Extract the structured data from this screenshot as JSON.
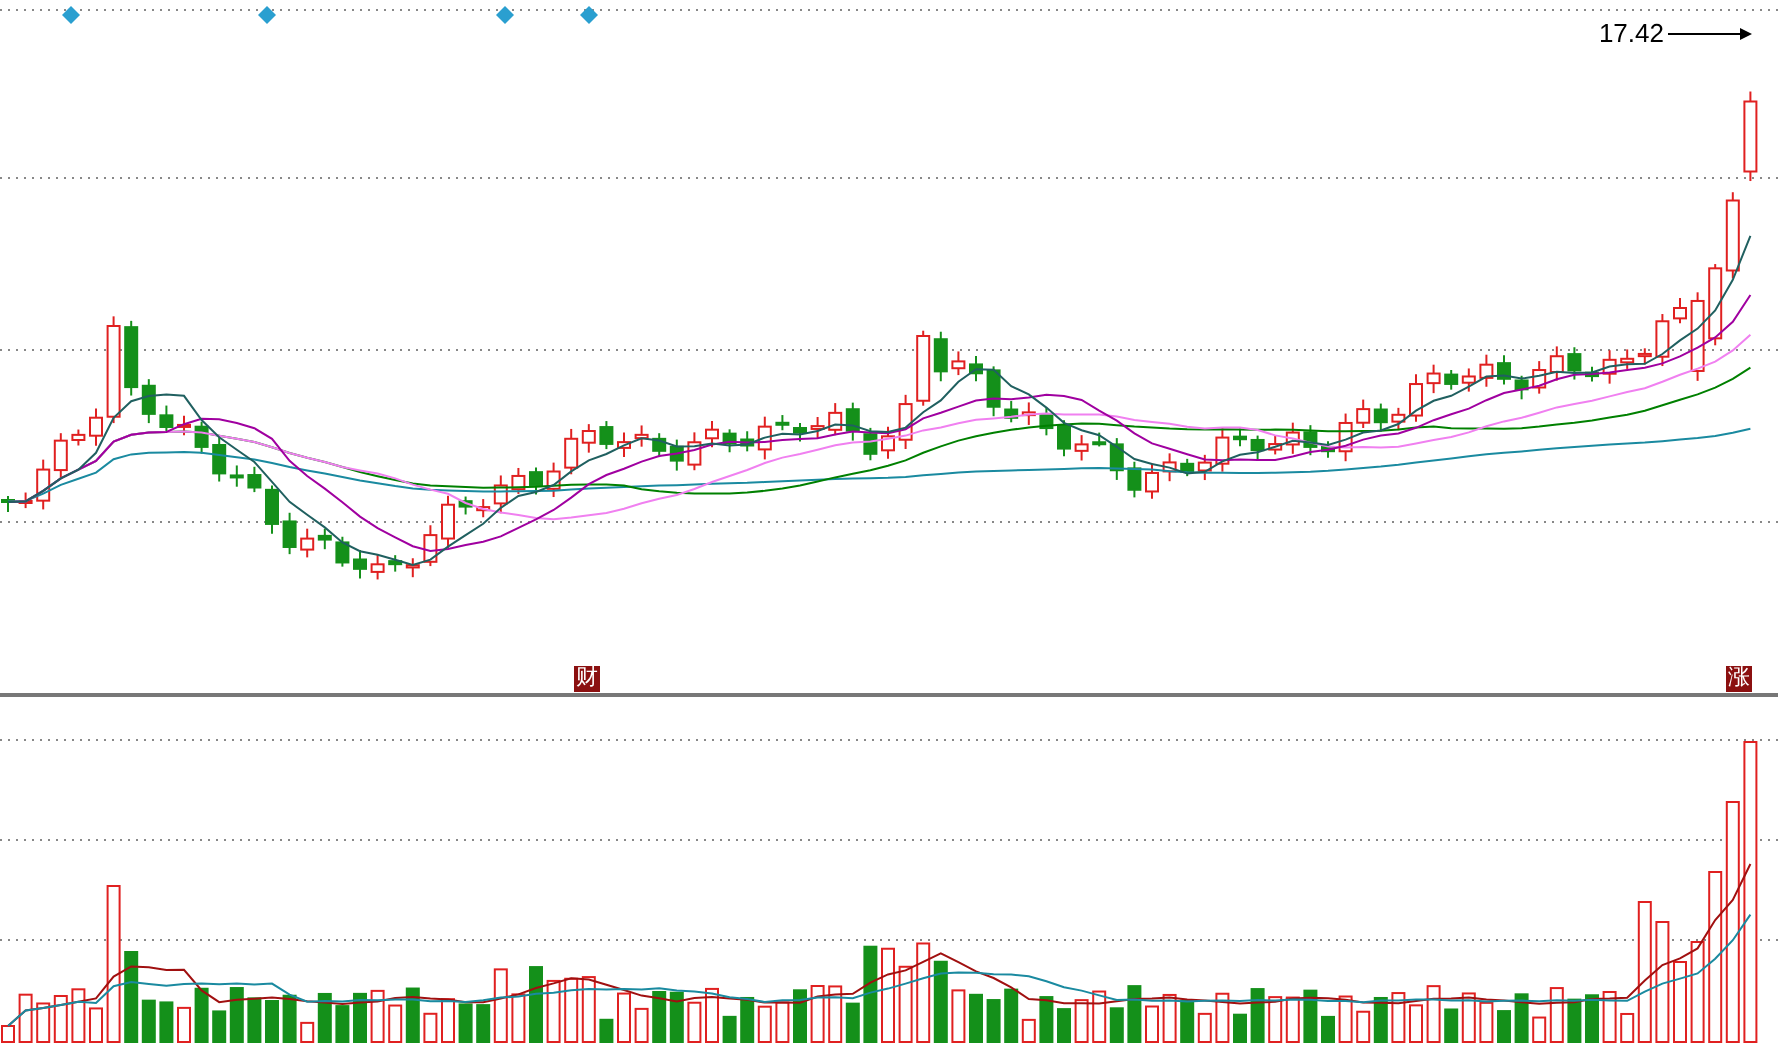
{
  "price_label": {
    "text": "17.42"
  },
  "event_markers": [
    {
      "text": "财"
    },
    {
      "text": "涨"
    }
  ]
}
